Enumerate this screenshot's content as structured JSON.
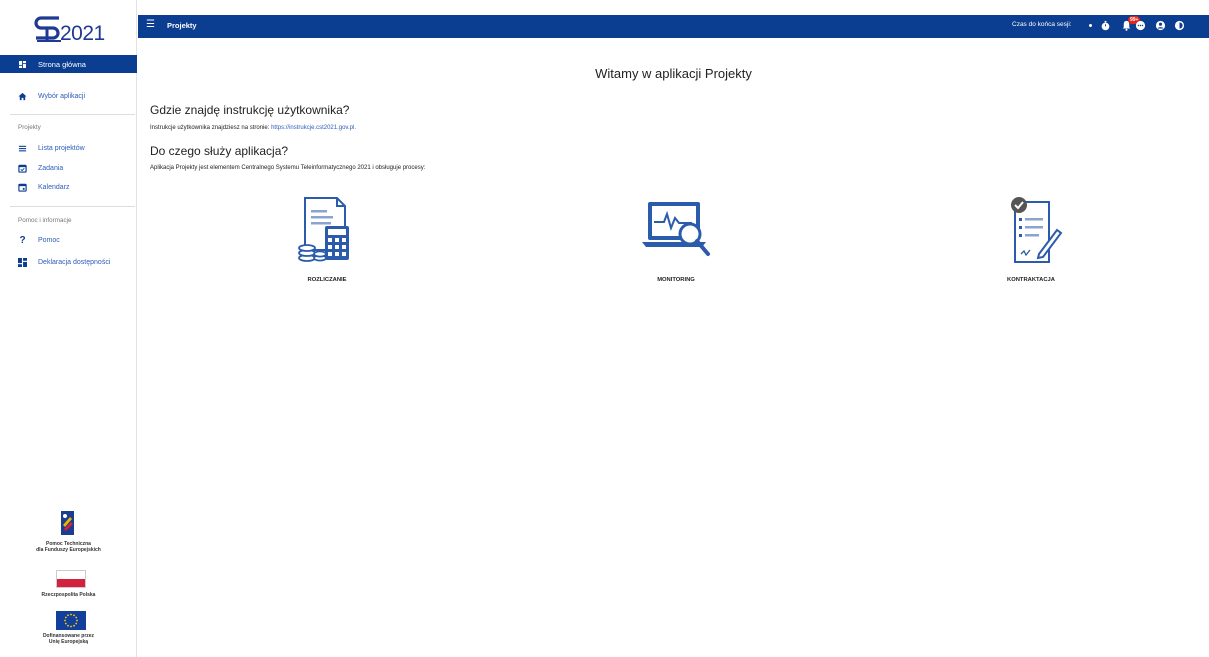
{
  "logo": {
    "year": "2021"
  },
  "sidebar": {
    "home_label": "Strona główna",
    "items": [
      {
        "label": "Wybór aplikacji",
        "icon": "home-icon"
      }
    ],
    "section_projects": "Projekty",
    "project_items": [
      {
        "label": "Lista projektów",
        "icon": "list-icon"
      },
      {
        "label": "Zadania",
        "icon": "tasks-icon"
      },
      {
        "label": "Kalendarz",
        "icon": "calendar-icon"
      }
    ],
    "section_help": "Pomoc i informacje",
    "help_items": [
      {
        "label": "Pomoc",
        "icon": "help-icon"
      },
      {
        "label": "Deklaracja dostępności",
        "icon": "accessibility-icon"
      }
    ],
    "funding": {
      "fe_line1": "Pomoc Techniczna",
      "fe_line2": "dla Funduszy Europejskich",
      "pl_label": "Rzeczpospolita Polska",
      "eu_line1": "Dofinansowane przez",
      "eu_line2": "Unię Europejską"
    }
  },
  "topbar": {
    "title": "Projekty",
    "session_label": "Czas do końca sesji:",
    "notification_badge": "99+"
  },
  "main": {
    "welcome": "Witamy w aplikacji Projekty",
    "q1": "Gdzie znajdę instrukcję użytkownika?",
    "q1_text": "Instrukcje użytkownika znajdziesz na stronie:",
    "q1_link": "https://instrukcje.cst2021.gov.pl.",
    "q2": "Do czego służy aplikacja?",
    "q2_text": "Aplikacja Projekty jest elementem Centralnego Systemu Teleinformatycznego 2021 i obsługuje procesy:",
    "processes": [
      {
        "label": "ROZLICZANIE",
        "icon": "settlement-icon"
      },
      {
        "label": "MONITORING",
        "icon": "monitoring-icon"
      },
      {
        "label": "KONTRAKTACJA",
        "icon": "contracting-icon"
      }
    ]
  },
  "colors": {
    "primary": "#0b3d91",
    "link": "#2e5cb8",
    "badge": "#e0271c",
    "pl_red": "#d4213d",
    "eu_blue": "#123f9c"
  }
}
